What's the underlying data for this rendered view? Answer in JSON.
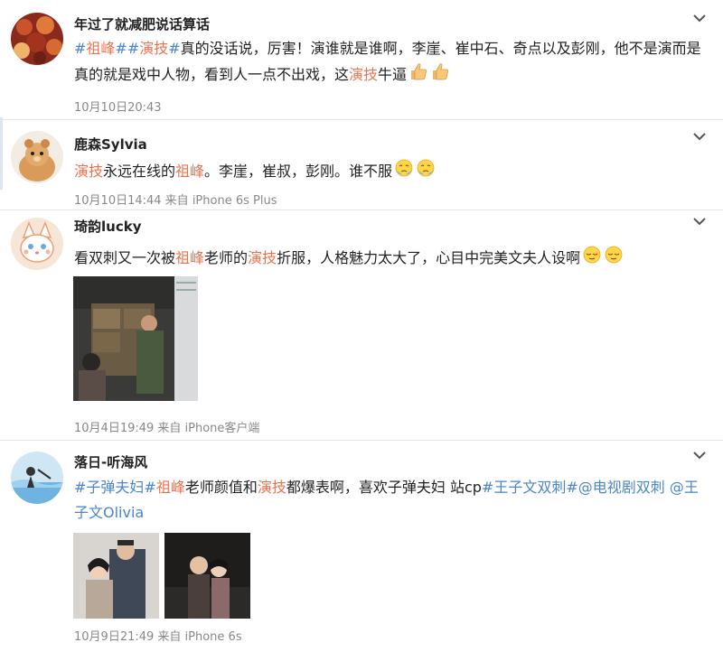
{
  "comments": [
    {
      "username": "年过了就减肥说话算话",
      "content": [
        {
          "t": "#",
          "k": "tag"
        },
        {
          "t": "祖峰",
          "k": "kw"
        },
        {
          "t": "#",
          "k": "tag"
        },
        {
          "t": "#",
          "k": "tag"
        },
        {
          "t": "演技",
          "k": "kw"
        },
        {
          "t": "#",
          "k": "tag"
        },
        {
          "t": "真的没话说，厉害！演谁就是谁啊，李崖、崔中石、奇点以及彭刚，他不是演而是真的就是戏中人物，看到人一点不出戏，这",
          "k": "plain"
        },
        {
          "t": "演技",
          "k": "kw"
        },
        {
          "t": "牛逼",
          "k": "plain"
        }
      ],
      "emojis": [
        "thumbs-up-emoji",
        "thumbs-up-emoji"
      ],
      "meta": "10月10日20:43"
    },
    {
      "username": "鹿森Sylvia",
      "content": [
        {
          "t": "演技",
          "k": "kw"
        },
        {
          "t": "永远在线的",
          "k": "plain"
        },
        {
          "t": "祖峰",
          "k": "kw"
        },
        {
          "t": "。李崖，崔叔，彭刚。谁不服",
          "k": "plain"
        }
      ],
      "emojis": [
        "crying-emoji",
        "crying-emoji"
      ],
      "meta": "10月10日14:44 来自 iPhone 6s Plus"
    },
    {
      "username": "琦韵lucky",
      "content": [
        {
          "t": "看双刺又一次被",
          "k": "plain"
        },
        {
          "t": "祖峰",
          "k": "kw"
        },
        {
          "t": "老师的",
          "k": "plain"
        },
        {
          "t": "演技",
          "k": "kw"
        },
        {
          "t": "折服，人格魅力太大了，心目中完美文夫人设啊",
          "k": "plain"
        }
      ],
      "emojis": [
        "relieved-emoji",
        "relieved-emoji"
      ],
      "meta": "10月4日19:49 来自 iPhone客户端"
    },
    {
      "username": "落日-听海风",
      "content": [
        {
          "t": "#子弹夫妇#",
          "k": "tag"
        },
        {
          "t": "祖峰",
          "k": "kw"
        },
        {
          "t": "老师颜值和",
          "k": "plain"
        },
        {
          "t": "演技",
          "k": "kw"
        },
        {
          "t": "都爆表啊，喜欢子弹夫妇 站cp",
          "k": "plain"
        },
        {
          "t": "#王子文双刺#",
          "k": "tag"
        },
        {
          "t": "@电视剧双刺",
          "k": "tag"
        },
        {
          "t": " ",
          "k": "plain"
        },
        {
          "t": "@王子文Olivia",
          "k": "tag"
        }
      ],
      "emojis": [],
      "meta": "10月9日21:49 来自 iPhone 6s"
    }
  ]
}
